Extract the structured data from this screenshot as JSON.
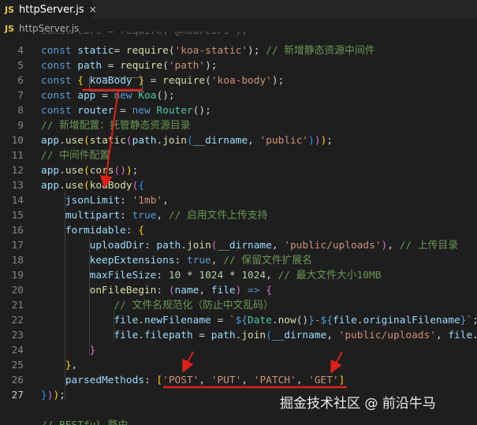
{
  "tab": {
    "icon_label": "JS",
    "filename": "httpServer.js",
    "close_glyph": "×"
  },
  "breadcrumb": {
    "icon_label": "JS",
    "path": "httpServer.js",
    "partial_top_code": "const cors = require('@koa/cors');"
  },
  "lines": [
    {
      "n": "4",
      "parts": [
        [
          "kw",
          "const "
        ],
        [
          "id",
          "static"
        ],
        [
          "",
          "= "
        ],
        [
          "fn",
          "require"
        ],
        [
          "",
          "("
        ],
        [
          "str",
          "'koa-static'"
        ],
        [
          "",
          ");"
        ],
        [
          "cm",
          " // 新增静态资源中间件"
        ]
      ]
    },
    {
      "n": "5",
      "parts": [
        [
          "kw",
          "const "
        ],
        [
          "id",
          "path"
        ],
        [
          "",
          " = "
        ],
        [
          "fn",
          "require"
        ],
        [
          "",
          "("
        ],
        [
          "str",
          "'path'"
        ],
        [
          "",
          ");"
        ]
      ]
    },
    {
      "n": "6",
      "parts": [
        [
          "kw",
          "const "
        ],
        [
          "br1",
          "{"
        ],
        [
          "",
          " "
        ],
        [
          "id",
          "koaBody"
        ],
        [
          "",
          " "
        ],
        [
          "br1",
          "}"
        ],
        [
          "",
          " = "
        ],
        [
          "fn",
          "require"
        ],
        [
          "",
          "("
        ],
        [
          "str",
          "'koa-body'"
        ],
        [
          "",
          ");"
        ]
      ]
    },
    {
      "n": "7",
      "parts": [
        [
          "kw",
          "const "
        ],
        [
          "id",
          "app"
        ],
        [
          "",
          " = "
        ],
        [
          "kw",
          "new "
        ],
        [
          "cls",
          "Koa"
        ],
        [
          "",
          "();"
        ]
      ]
    },
    {
      "n": "8",
      "parts": [
        [
          "kw",
          "const "
        ],
        [
          "id",
          "router"
        ],
        [
          "",
          " = "
        ],
        [
          "kw",
          "new "
        ],
        [
          "cls",
          "Router"
        ],
        [
          "",
          "();"
        ]
      ]
    },
    {
      "n": "9",
      "parts": [
        [
          "cm",
          "// 新增配置：托管静态资源目录"
        ]
      ]
    },
    {
      "n": "10",
      "parts": [
        [
          "id",
          "app"
        ],
        [
          "",
          "."
        ],
        [
          "fn",
          "use"
        ],
        [
          "br1",
          "("
        ],
        [
          "fn",
          "static"
        ],
        [
          "br2",
          "("
        ],
        [
          "id",
          "path"
        ],
        [
          "",
          "."
        ],
        [
          "fn",
          "join"
        ],
        [
          "br3",
          "("
        ],
        [
          "id",
          "__dirname"
        ],
        [
          "",
          ", "
        ],
        [
          "str",
          "'public'"
        ],
        [
          "br3",
          ")"
        ],
        [
          "br2",
          ")"
        ],
        [
          "br1",
          ")"
        ],
        [
          "",
          ";"
        ]
      ]
    },
    {
      "n": "11",
      "parts": [
        [
          "cm",
          "// 中间件配置"
        ]
      ]
    },
    {
      "n": "12",
      "parts": [
        [
          "id",
          "app"
        ],
        [
          "",
          "."
        ],
        [
          "fn",
          "use"
        ],
        [
          "br1",
          "("
        ],
        [
          "fn",
          "cors"
        ],
        [
          "br2",
          "()"
        ],
        [
          "br1",
          ")"
        ],
        [
          "",
          ";"
        ]
      ]
    },
    {
      "n": "13",
      "parts": [
        [
          "id",
          "app"
        ],
        [
          "",
          "."
        ],
        [
          "fn",
          "use"
        ],
        [
          "br1",
          "("
        ],
        [
          "fn",
          "koaBody"
        ],
        [
          "br2",
          "("
        ],
        [
          "br3",
          "{"
        ]
      ]
    },
    {
      "n": "14",
      "parts": [
        [
          "",
          "    "
        ],
        [
          "id",
          "jsonLimit"
        ],
        [
          "",
          ": "
        ],
        [
          "str",
          "'1mb'"
        ],
        [
          "",
          ","
        ]
      ]
    },
    {
      "n": "15",
      "parts": [
        [
          "",
          "    "
        ],
        [
          "id",
          "multipart"
        ],
        [
          "",
          ": "
        ],
        [
          "kw",
          "true"
        ],
        [
          "",
          ", "
        ],
        [
          "cm",
          "// 启用文件上传支持"
        ]
      ]
    },
    {
      "n": "16",
      "parts": [
        [
          "",
          "    "
        ],
        [
          "id",
          "formidable"
        ],
        [
          "",
          ": "
        ],
        [
          "br1",
          "{"
        ]
      ]
    },
    {
      "n": "17",
      "parts": [
        [
          "",
          "        "
        ],
        [
          "id",
          "uploadDir"
        ],
        [
          "",
          ": "
        ],
        [
          "id",
          "path"
        ],
        [
          "",
          "."
        ],
        [
          "fn",
          "join"
        ],
        [
          "br2",
          "("
        ],
        [
          "id",
          "__dirname"
        ],
        [
          "",
          ", "
        ],
        [
          "str",
          "'public/uploads'"
        ],
        [
          "br2",
          ")"
        ],
        [
          "",
          ", "
        ],
        [
          "cm",
          "// 上传目录"
        ]
      ]
    },
    {
      "n": "18",
      "parts": [
        [
          "",
          "        "
        ],
        [
          "id",
          "keepExtensions"
        ],
        [
          "",
          ": "
        ],
        [
          "kw",
          "true"
        ],
        [
          "",
          ", "
        ],
        [
          "cm",
          "// 保留文件扩展名"
        ]
      ]
    },
    {
      "n": "19",
      "parts": [
        [
          "",
          "        "
        ],
        [
          "id",
          "maxFileSize"
        ],
        [
          "",
          ": "
        ],
        [
          "num",
          "10"
        ],
        [
          "",
          " * "
        ],
        [
          "num",
          "1024"
        ],
        [
          "",
          " * "
        ],
        [
          "num",
          "1024"
        ],
        [
          "",
          ", "
        ],
        [
          "cm",
          "// 最大文件大小10MB"
        ]
      ]
    },
    {
      "n": "20",
      "parts": [
        [
          "",
          "        "
        ],
        [
          "fn",
          "onFileBegin"
        ],
        [
          "",
          ": "
        ],
        [
          "br2",
          "("
        ],
        [
          "id",
          "name"
        ],
        [
          "",
          ", "
        ],
        [
          "id",
          "file"
        ],
        [
          "br2",
          ")"
        ],
        [
          "",
          " "
        ],
        [
          "kw",
          "=>"
        ],
        [
          "",
          " "
        ],
        [
          "br2",
          "{"
        ]
      ]
    },
    {
      "n": "21",
      "parts": [
        [
          "",
          "            "
        ],
        [
          "cm",
          "// 文件名规范化（防止中文乱码）"
        ]
      ]
    },
    {
      "n": "22",
      "parts": [
        [
          "",
          "            "
        ],
        [
          "id",
          "file"
        ],
        [
          "",
          "."
        ],
        [
          "id",
          "newFilename"
        ],
        [
          "",
          " = "
        ],
        [
          "str",
          "`"
        ],
        [
          "tpl",
          "${"
        ],
        [
          "cls",
          "Date"
        ],
        [
          "",
          "."
        ],
        [
          "fn",
          "now"
        ],
        [
          "",
          "()"
        ],
        [
          "tpl",
          "}"
        ],
        [
          "str",
          "-"
        ],
        [
          "tpl",
          "${"
        ],
        [
          "id",
          "file"
        ],
        [
          "",
          "."
        ],
        [
          "id",
          "originalFilename"
        ],
        [
          "tpl",
          "}"
        ],
        [
          "str",
          "`"
        ],
        [
          "",
          ";"
        ]
      ]
    },
    {
      "n": "23",
      "parts": [
        [
          "",
          "            "
        ],
        [
          "id",
          "file"
        ],
        [
          "",
          "."
        ],
        [
          "id",
          "filepath"
        ],
        [
          "",
          " = "
        ],
        [
          "id",
          "path"
        ],
        [
          "",
          "."
        ],
        [
          "fn",
          "join"
        ],
        [
          "br3",
          "("
        ],
        [
          "id",
          "__dirname"
        ],
        [
          "",
          ", "
        ],
        [
          "str",
          "'public/uploads'"
        ],
        [
          "",
          ", "
        ],
        [
          "id",
          "file"
        ],
        [
          "",
          "."
        ]
      ]
    },
    {
      "n": "24",
      "parts": [
        [
          "",
          "        "
        ],
        [
          "br2",
          "}"
        ]
      ]
    },
    {
      "n": "25",
      "parts": [
        [
          "",
          "    "
        ],
        [
          "br1",
          "}"
        ],
        [
          "",
          ","
        ]
      ]
    },
    {
      "n": "26",
      "parts": [
        [
          "",
          "    "
        ],
        [
          "id",
          "parsedMethods"
        ],
        [
          "",
          ": "
        ],
        [
          "br1",
          "["
        ],
        [
          "str",
          "'POST'"
        ],
        [
          "",
          ", "
        ],
        [
          "str",
          "'PUT'"
        ],
        [
          "",
          ", "
        ],
        [
          "str",
          "'PATCH'"
        ],
        [
          "",
          ", "
        ],
        [
          "str",
          "'GET'"
        ],
        [
          "br1",
          "]"
        ]
      ]
    },
    {
      "n": "27",
      "parts": [
        [
          "br3",
          "}"
        ],
        [
          "br2",
          ")"
        ],
        [
          "br1",
          ")"
        ],
        [
          "",
          ";"
        ]
      ]
    },
    {
      "n": "",
      "parts": []
    },
    {
      "n": "",
      "parts": [
        [
          "cm",
          "// RESTful 路由"
        ]
      ]
    }
  ],
  "current_line": "27",
  "watermark": "掘金技术社区 @ 前沿牛马",
  "annotation_color": "#e0201a"
}
